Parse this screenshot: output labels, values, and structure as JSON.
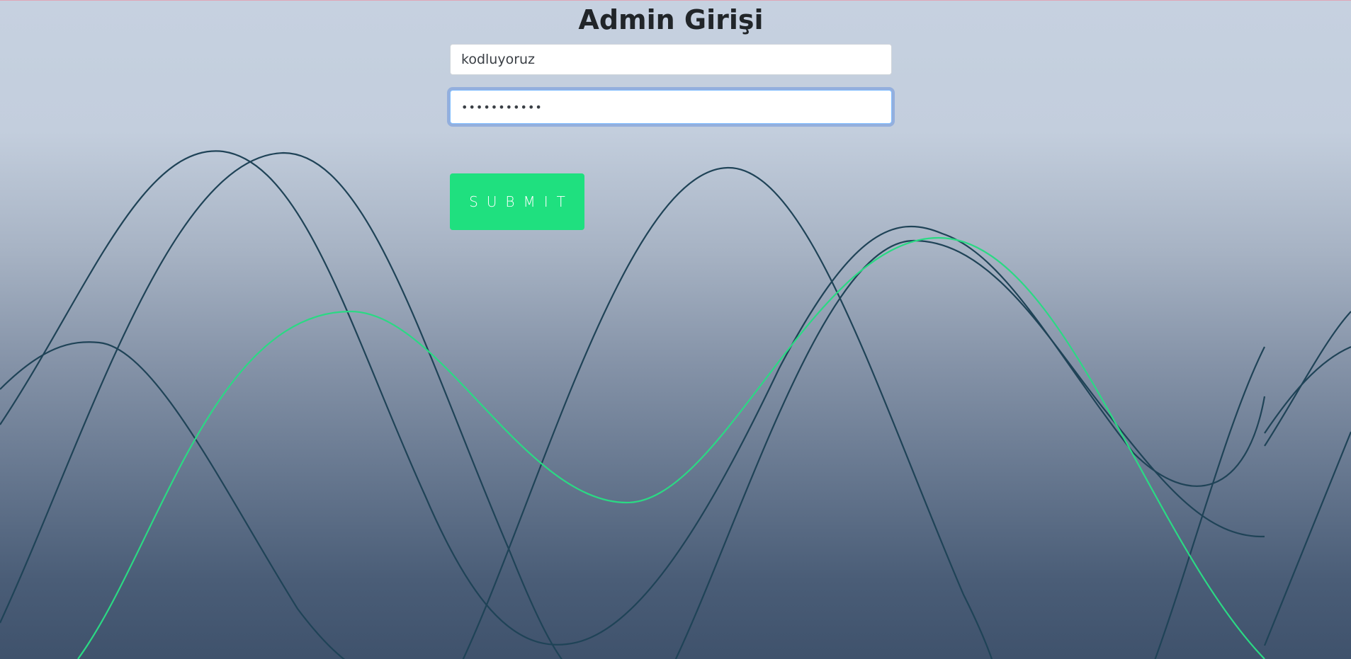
{
  "page": {
    "title": "Admin Girişi"
  },
  "form": {
    "username_value": "kodluyoruz",
    "password_value": "•••••••••••",
    "submit_label": "SUBMIT"
  },
  "theme": {
    "accent_green": "#1fe07f",
    "wave_dark": "#1f4357",
    "wave_green": "#2bd984"
  }
}
